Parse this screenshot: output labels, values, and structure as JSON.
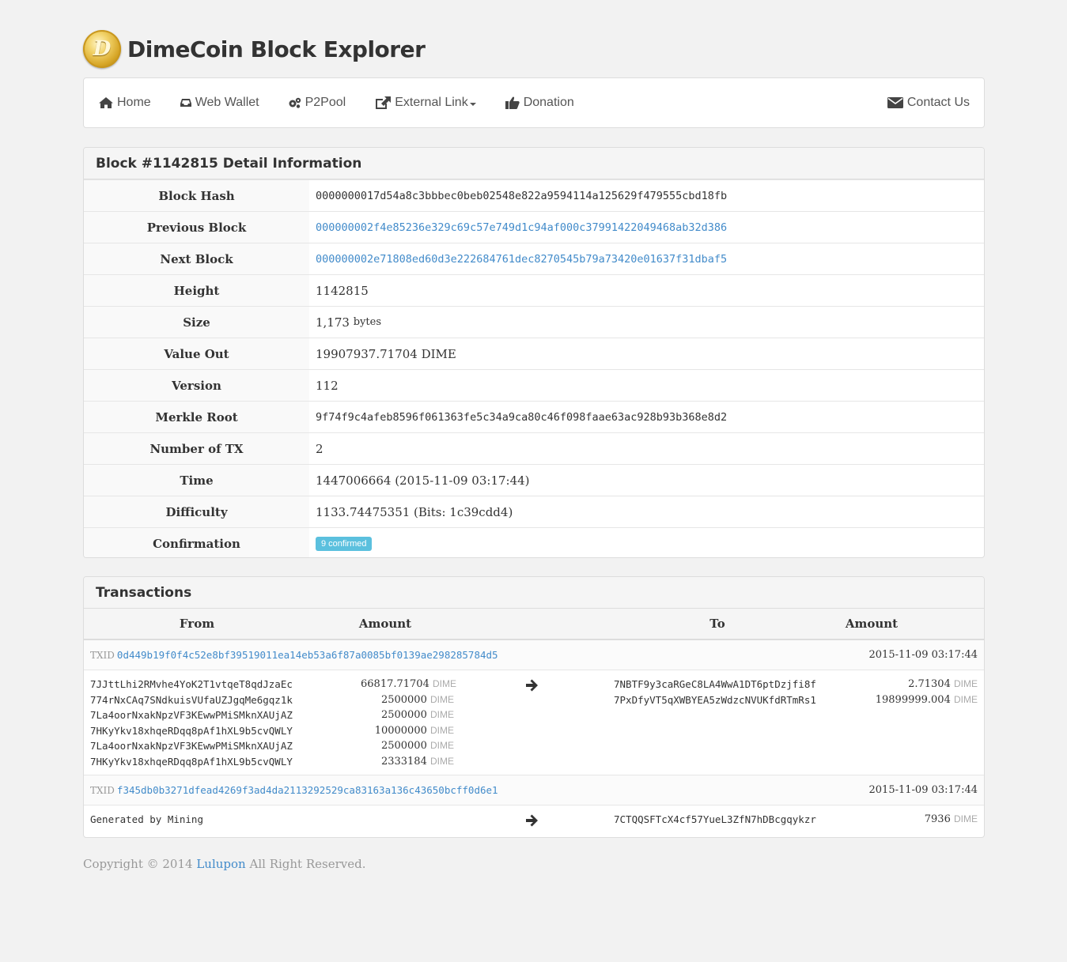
{
  "brand": {
    "logo_letter": "D",
    "title": "DimeCoin Block Explorer"
  },
  "nav": {
    "home": "Home",
    "web_wallet": "Web Wallet",
    "p2pool": "P2Pool",
    "external_link": "External Link",
    "donation": "Donation",
    "contact": "Contact Us"
  },
  "detail": {
    "heading": "Block #1142815 Detail Information",
    "rows": {
      "block_hash": {
        "label": "Block Hash",
        "value": "0000000017d54a8c3bbbec0beb02548e822a9594114a125629f479555cbd18fb"
      },
      "previous_block": {
        "label": "Previous Block",
        "value": "000000002f4e85236e329c69c57e749d1c94af000c37991422049468ab32d386"
      },
      "next_block": {
        "label": "Next Block",
        "value": "000000002e71808ed60d3e222684761dec8270545b79a73420e01637f31dbaf5"
      },
      "height": {
        "label": "Height",
        "value": "1142815"
      },
      "size": {
        "label": "Size",
        "value": "1,173",
        "unit": "bytes"
      },
      "value_out": {
        "label": "Value Out",
        "value": "19907937.71704 DIME"
      },
      "version": {
        "label": "Version",
        "value": "112"
      },
      "merkle_root": {
        "label": "Merkle Root",
        "value": "9f74f9c4afeb8596f061363fe5c34a9ca80c46f098faae63ac928b93b368e8d2"
      },
      "num_tx": {
        "label": "Number of TX",
        "value": "2"
      },
      "time": {
        "label": "Time",
        "value": "1447006664 (2015-11-09 03:17:44)"
      },
      "difficulty": {
        "label": "Difficulty",
        "value": "1133.74475351 (Bits: 1c39cdd4)"
      },
      "confirmation": {
        "label": "Confirmation",
        "value": "9 confirmed"
      }
    }
  },
  "transactions": {
    "heading": "Transactions",
    "columns": {
      "from": "From",
      "amount": "Amount",
      "to": "To",
      "amount2": "Amount"
    },
    "txid_label": "TXID",
    "unit": "DIME",
    "tx1": {
      "txid": "0d449b19f0f4c52e8bf39519011ea14eb53a6f87a0085bf0139ae298285784d5",
      "time": "2015-11-09 03:17:44",
      "inputs": [
        {
          "address": "7JJttLhi2RMvhe4YoK2T1vtqeT8qdJzaEc",
          "amount": "66817.71704"
        },
        {
          "address": "774rNxCAq7SNdkuisVUfaUZJgqMe6gqz1k",
          "amount": "2500000"
        },
        {
          "address": "7La4oorNxakNpzVF3KEwwPMiSMknXAUjAZ",
          "amount": "2500000"
        },
        {
          "address": "7HKyYkv18xhqeRDqq8pAf1hXL9b5cvQWLY",
          "amount": "10000000"
        },
        {
          "address": "7La4oorNxakNpzVF3KEwwPMiSMknXAUjAZ",
          "amount": "2500000"
        },
        {
          "address": "7HKyYkv18xhqeRDqq8pAf1hXL9b5cvQWLY",
          "amount": "2333184"
        }
      ],
      "outputs": [
        {
          "address": "7NBTF9y3caRGeC8LA4WwA1DT6ptDzjfi8f",
          "amount": "2.71304"
        },
        {
          "address": "7PxDfyVT5qXWBYEA5zWdzcNVUKfdRTmRs1",
          "amount": "19899999.004"
        }
      ]
    },
    "tx2": {
      "txid": "f345db0b3271dfead4269f3ad4da2113292529ca83163a136c43650bcff0d6e1",
      "time": "2015-11-09 03:17:44",
      "from_text": "Generated by Mining",
      "outputs": [
        {
          "address": "7CTQQSFTcX4cf57YueL3ZfN7hDBcgqykzr",
          "amount": "7936"
        }
      ]
    }
  },
  "footer": {
    "prefix": "Copyright © 2014",
    "link": "Lulupon",
    "suffix": "All Right Reserved."
  },
  "colors": {
    "link": "#428bca",
    "badge": "#5bc0de"
  }
}
